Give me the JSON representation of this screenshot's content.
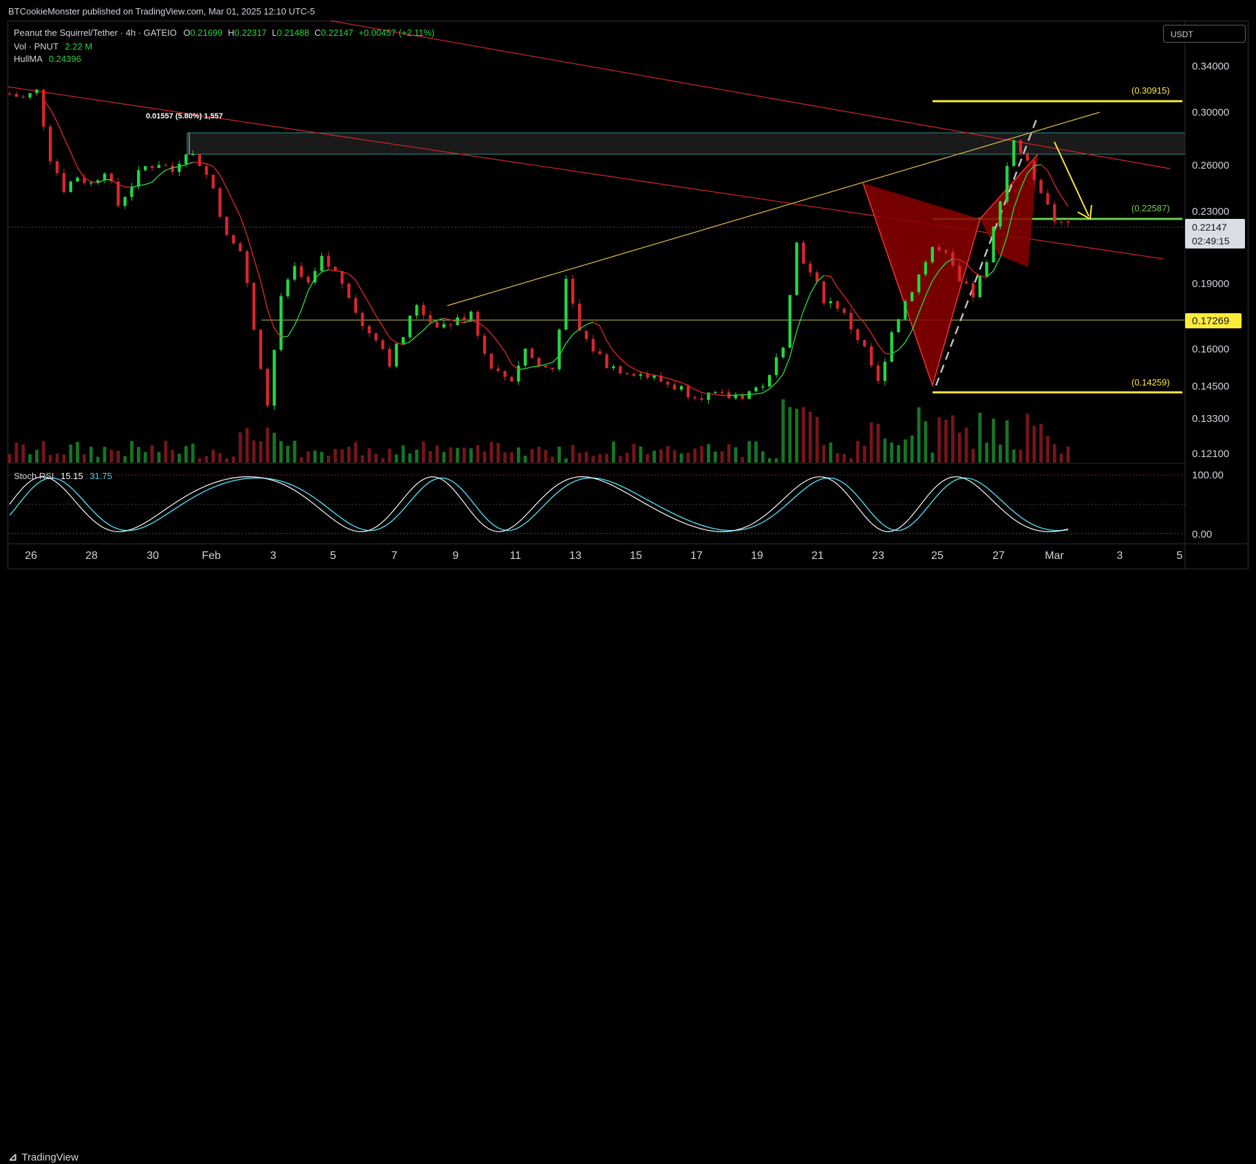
{
  "header": {
    "published": "BTCookieMonster published on TradingView.com, Mar 01, 2025 12:10 UTC-5"
  },
  "legend": {
    "symbol": "Peanut the Squirrel/Tether · 4h · GATEIO",
    "o_label": "O",
    "o": "0.21699",
    "h_label": "H",
    "h": "0.22317",
    "l_label": "L",
    "l": "0.21488",
    "c_label": "C",
    "c": "0.22147",
    "change": "+0.00457 (+2.11%)",
    "vol_label": "Vol · PNUT",
    "vol": "2.22 M",
    "hma_label": "HullMA",
    "hma": "0.24396",
    "rsi_label": "Stoch RSI",
    "rsi_k": "15.15",
    "rsi_d": "31.75"
  },
  "currency": "USDT",
  "footer": {
    "brand": "TradingView"
  },
  "colors": {
    "up": "#26d640",
    "down": "#d8262b",
    "annotation": "#ffeb3b",
    "level_line": "#6fcf50",
    "pattern": "#8b0000"
  },
  "chart_data": {
    "type": "candlestick",
    "title": "Peanut the Squirrel/Tether · 4h · GATEIO",
    "price_axis": {
      "ylim": [
        0.115,
        0.37
      ],
      "ticks": [
        "0.34000",
        "0.30000",
        "0.26000",
        "0.23000",
        "0.19000",
        "0.16000",
        "0.14500",
        "0.13300",
        "0.12100"
      ]
    },
    "time_axis": {
      "ticks": [
        "26",
        "28",
        "30",
        "Feb",
        "3",
        "5",
        "7",
        "9",
        "11",
        "13",
        "15",
        "17",
        "19",
        "21",
        "23",
        "25",
        "27",
        "Mar",
        "3",
        "5"
      ]
    },
    "current_price": {
      "value": "0.22147",
      "countdown": "02:49:15"
    },
    "marked_price": "0.17269",
    "annotations": {
      "measure": "0.01557 (5.80%) 1,557",
      "level_high": "(0.30915)",
      "level_mid": "(0.22587)",
      "level_low": "(0.14259)"
    },
    "close_points_approx": [
      [
        0,
        0.316
      ],
      [
        6,
        0.312
      ],
      [
        12,
        0.318
      ],
      [
        18,
        0.266
      ],
      [
        24,
        0.245
      ],
      [
        30,
        0.253
      ],
      [
        36,
        0.248
      ],
      [
        42,
        0.258
      ],
      [
        48,
        0.234
      ],
      [
        54,
        0.248
      ],
      [
        60,
        0.259
      ],
      [
        66,
        0.262
      ],
      [
        72,
        0.256
      ],
      [
        78,
        0.272
      ],
      [
        84,
        0.262
      ],
      [
        90,
        0.245
      ],
      [
        96,
        0.215
      ],
      [
        102,
        0.208
      ],
      [
        108,
        0.17
      ],
      [
        114,
        0.138
      ],
      [
        120,
        0.182
      ],
      [
        126,
        0.198
      ],
      [
        132,
        0.188
      ],
      [
        138,
        0.203
      ],
      [
        144,
        0.196
      ],
      [
        150,
        0.186
      ],
      [
        156,
        0.17
      ],
      [
        162,
        0.166
      ],
      [
        168,
        0.155
      ],
      [
        174,
        0.166
      ],
      [
        180,
        0.181
      ],
      [
        186,
        0.173
      ],
      [
        192,
        0.171
      ],
      [
        198,
        0.173
      ],
      [
        204,
        0.178
      ],
      [
        210,
        0.158
      ],
      [
        216,
        0.15
      ],
      [
        222,
        0.148
      ],
      [
        228,
        0.16
      ],
      [
        234,
        0.153
      ],
      [
        240,
        0.152
      ],
      [
        246,
        0.19
      ],
      [
        252,
        0.168
      ],
      [
        258,
        0.16
      ],
      [
        264,
        0.154
      ],
      [
        270,
        0.152
      ],
      [
        276,
        0.151
      ],
      [
        282,
        0.149
      ],
      [
        288,
        0.147
      ],
      [
        294,
        0.145
      ],
      [
        300,
        0.143
      ],
      [
        306,
        0.142
      ],
      [
        312,
        0.141
      ],
      [
        318,
        0.141
      ],
      [
        324,
        0.142
      ],
      [
        330,
        0.144
      ],
      [
        336,
        0.148
      ],
      [
        342,
        0.163
      ],
      [
        348,
        0.212
      ],
      [
        354,
        0.195
      ],
      [
        360,
        0.183
      ],
      [
        366,
        0.18
      ],
      [
        372,
        0.17
      ],
      [
        378,
        0.16
      ],
      [
        384,
        0.146
      ],
      [
        390,
        0.168
      ],
      [
        396,
        0.182
      ],
      [
        402,
        0.195
      ],
      [
        408,
        0.21
      ],
      [
        414,
        0.205
      ],
      [
        420,
        0.19
      ],
      [
        426,
        0.185
      ],
      [
        432,
        0.2
      ],
      [
        438,
        0.24
      ],
      [
        444,
        0.28
      ],
      [
        450,
        0.26
      ],
      [
        456,
        0.245
      ],
      [
        462,
        0.225
      ],
      [
        468,
        0.221
      ]
    ],
    "grid": false
  }
}
